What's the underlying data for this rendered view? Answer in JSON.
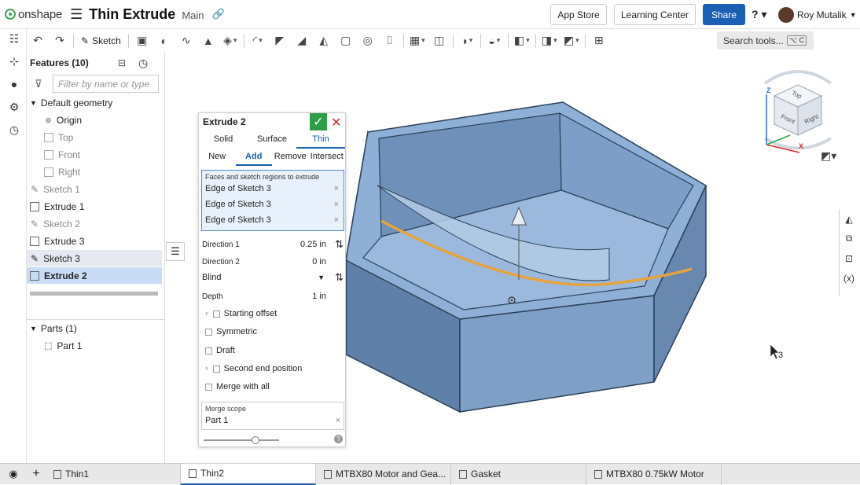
{
  "header": {
    "brand": "onshape",
    "document_title": "Thin Extrude",
    "branch": "Main",
    "app_store": "App Store",
    "learning_center": "Learning Center",
    "share": "Share",
    "help": "?",
    "user_name": "Roy Mutalik"
  },
  "toolbar": {
    "sketch_label": "Sketch",
    "search_placeholder": "Search tools...",
    "search_shortcut": "⌥ C"
  },
  "features": {
    "header": "Features (10)",
    "filter_placeholder": "Filter by name or type",
    "default_geometry": "Default geometry",
    "items": [
      "Origin",
      "Top",
      "Front",
      "Right",
      "Sketch 1",
      "Extrude 1",
      "Sketch 2",
      "Extrude 3",
      "Sketch 3",
      "Extrude 2"
    ],
    "parts_header": "Parts (1)",
    "parts": [
      "Part 1"
    ]
  },
  "dialog": {
    "title": "Extrude 2",
    "body_tabs": [
      "Solid",
      "Surface",
      "Thin"
    ],
    "op_tabs": [
      "New",
      "Add",
      "Remove",
      "Intersect"
    ],
    "regions_hint": "Faces and sketch regions to extrude",
    "regions": [
      "Edge of Sketch 3",
      "Edge of Sketch 3",
      "Edge of Sketch 3"
    ],
    "direction1_label": "Direction 1",
    "direction1_value": "0.25 in",
    "direction2_label": "Direction 2",
    "direction2_value": "0 in",
    "end_type": "Blind",
    "depth_label": "Depth",
    "depth_value": "1 in",
    "starting_offset": "Starting offset",
    "symmetric": "Symmetric",
    "draft": "Draft",
    "second_end": "Second end position",
    "merge_with_all": "Merge with all",
    "merge_scope_label": "Merge scope",
    "merge_scope_value": "Part 1"
  },
  "viewcube": {
    "top": "Top",
    "front": "Front",
    "right": "Right",
    "axis_z": "Z",
    "axis_x": "X"
  },
  "viewport": {
    "cursor_badge": "3"
  },
  "bottom_tabs": [
    "Thin1",
    "Thin2",
    "MTBX80 Motor and Gea...",
    "Gasket",
    "MTBX80 0.75kW Motor"
  ],
  "colors": {
    "part_face": "#8fb0d6",
    "part_edge": "#2b3f57",
    "sketch_edge": "#e8a33a",
    "accent": "#1a5fb4"
  }
}
